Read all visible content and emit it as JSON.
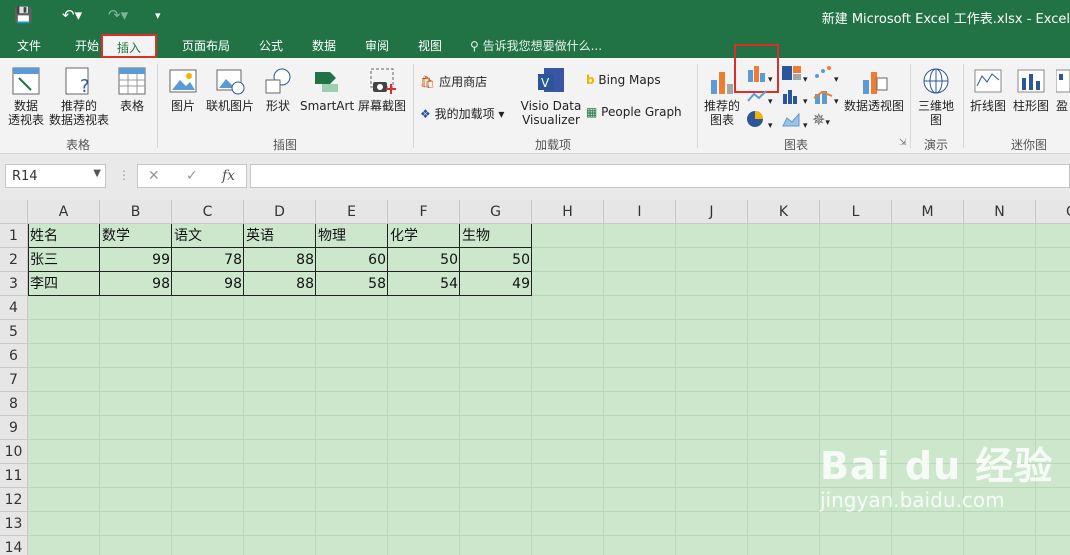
{
  "window": {
    "title": "新建 Microsoft Excel 工作表.xlsx - Excel"
  },
  "tabs": [
    "文件",
    "开始",
    "插入",
    "页面布局",
    "公式",
    "数据",
    "审阅",
    "视图"
  ],
  "tell_me": "告诉我您想要做什么...",
  "ribbon": {
    "tables": {
      "pivot": "数据\n透视表",
      "recommended_pivot": "推荐的\n数据透视表",
      "table": "表格",
      "group": "表格"
    },
    "illustrations": {
      "pictures": "图片",
      "online_pictures": "联机图片",
      "shapes": "形状",
      "smartart": "SmartArt",
      "screenshot": "屏幕截图",
      "group": "插图"
    },
    "addins": {
      "store": "应用商店",
      "my_addins": "我的加载项",
      "visio": "Visio Data\nVisualizer",
      "bing_maps": "Bing Maps",
      "people_graph": "People Graph",
      "group": "加载项"
    },
    "charts": {
      "recommended": "推荐的\n图表",
      "pivot_chart": "数据透视图",
      "group": "图表"
    },
    "tours": {
      "map3d": "三维地\n图",
      "group": "演示"
    },
    "sparklines": {
      "line": "折线图",
      "column": "柱形图",
      "winloss": "盈",
      "group": "迷你图"
    }
  },
  "name_box": "R14",
  "fx_label": "fx",
  "columns": [
    "A",
    "B",
    "C",
    "D",
    "E",
    "F",
    "G",
    "H",
    "I",
    "J",
    "K",
    "L",
    "M",
    "N",
    "O"
  ],
  "rows": [
    "1",
    "2",
    "3",
    "4",
    "5",
    "6",
    "7",
    "8",
    "9",
    "10",
    "11",
    "12",
    "13",
    "14"
  ],
  "sheet": {
    "header": [
      "姓名",
      "数学",
      "语文",
      "英语",
      "物理",
      "化学",
      "生物"
    ],
    "data": [
      [
        "张三",
        "99",
        "78",
        "88",
        "60",
        "50",
        "50"
      ],
      [
        "李四",
        "98",
        "98",
        "88",
        "58",
        "54",
        "49"
      ]
    ]
  },
  "watermark": {
    "brand": "Bai du 经验",
    "url": "jingyan.baidu.com"
  },
  "colors": {
    "excel_green": "#217346",
    "highlight": "#d9302a",
    "sheet_bg": "#cde7cd"
  }
}
